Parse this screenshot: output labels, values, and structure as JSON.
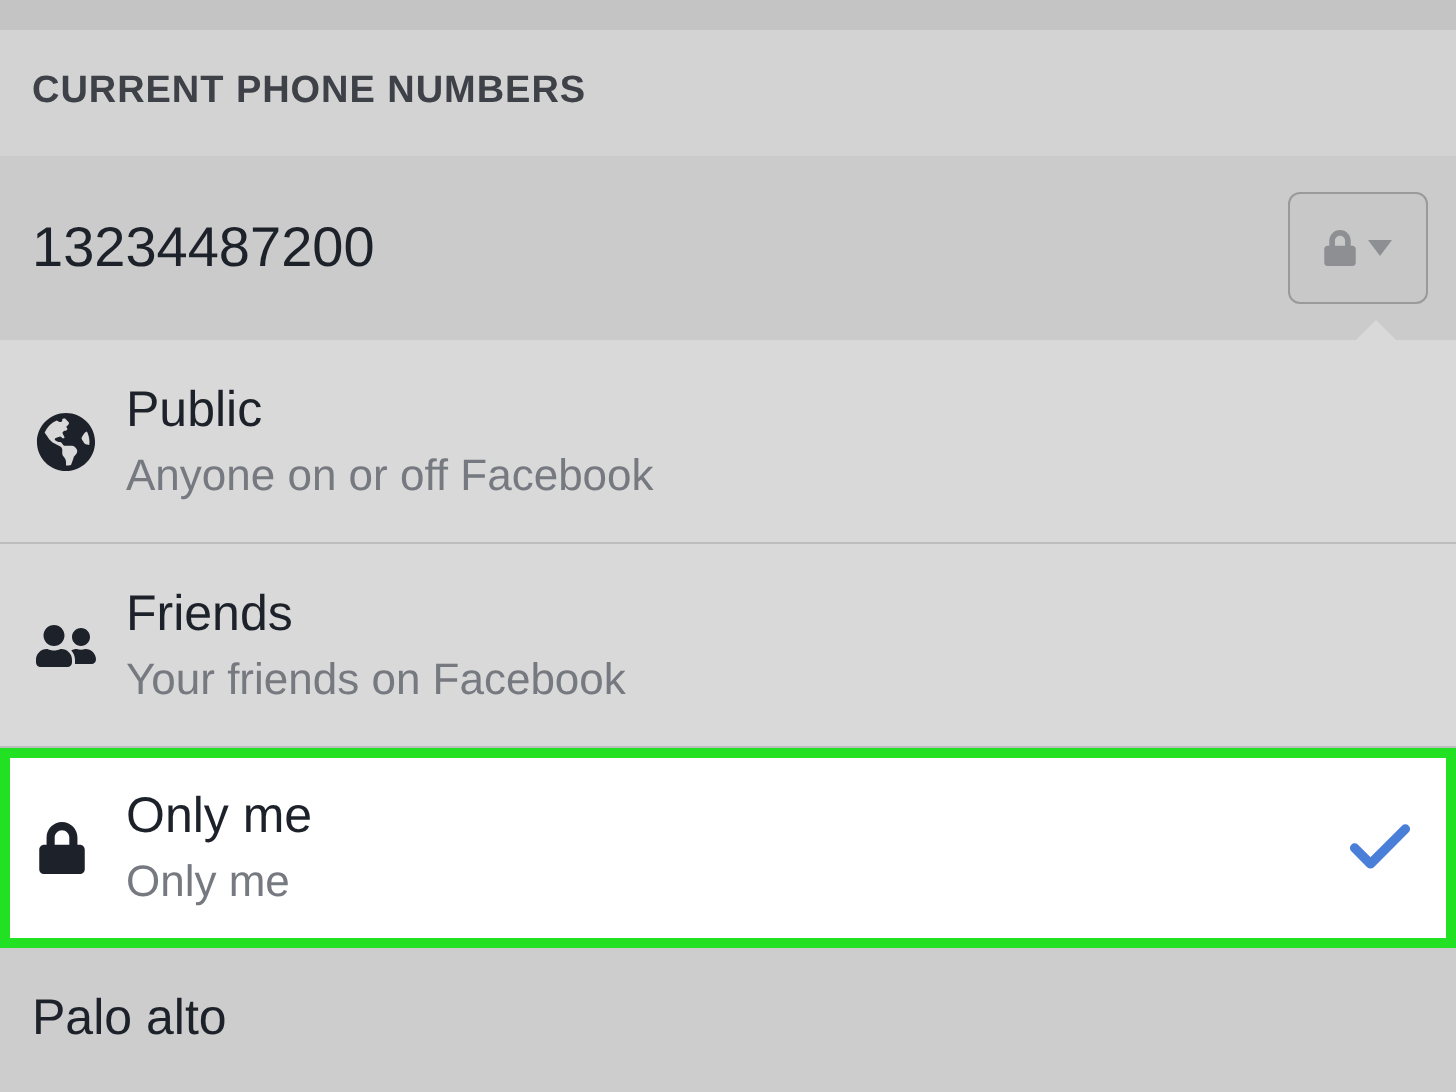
{
  "section_header": "CURRENT PHONE NUMBERS",
  "phone_number": "13234487200",
  "privacy_menu": [
    {
      "kind": "public",
      "title": "Public",
      "subtitle": "Anyone on or off Facebook",
      "selected": false
    },
    {
      "kind": "friends",
      "title": "Friends",
      "subtitle": "Your friends on Facebook",
      "selected": false
    },
    {
      "kind": "only_me",
      "title": "Only me",
      "subtitle": "Only me",
      "selected": true
    }
  ],
  "next_row": "Palo alto"
}
